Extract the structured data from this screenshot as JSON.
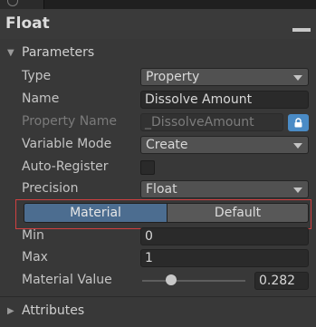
{
  "node": {
    "title": "Float",
    "parameters_header": "Parameters",
    "attributes_header": "Attributes"
  },
  "fields": {
    "type": {
      "label": "Type",
      "value": "Property"
    },
    "name": {
      "label": "Name",
      "value": "Dissolve Amount"
    },
    "property_name": {
      "label": "Property Name",
      "value": "_DissolveAmount"
    },
    "variable_mode": {
      "label": "Variable Mode",
      "value": "Create"
    },
    "auto_register": {
      "label": "Auto-Register",
      "checked": false
    },
    "precision": {
      "label": "Precision",
      "value": "Float"
    },
    "min": {
      "label": "Min",
      "value": "0"
    },
    "max": {
      "label": "Max",
      "value": "1"
    },
    "material_value": {
      "label": "Material Value",
      "value": "0.282",
      "fraction": 0.282
    }
  },
  "toggle": {
    "material_label": "Material",
    "default_label": "Default",
    "selected": "Material"
  },
  "colors": {
    "accent": "#4c6d90",
    "lock": "#4a8bc6",
    "highlight": "#d04040"
  }
}
